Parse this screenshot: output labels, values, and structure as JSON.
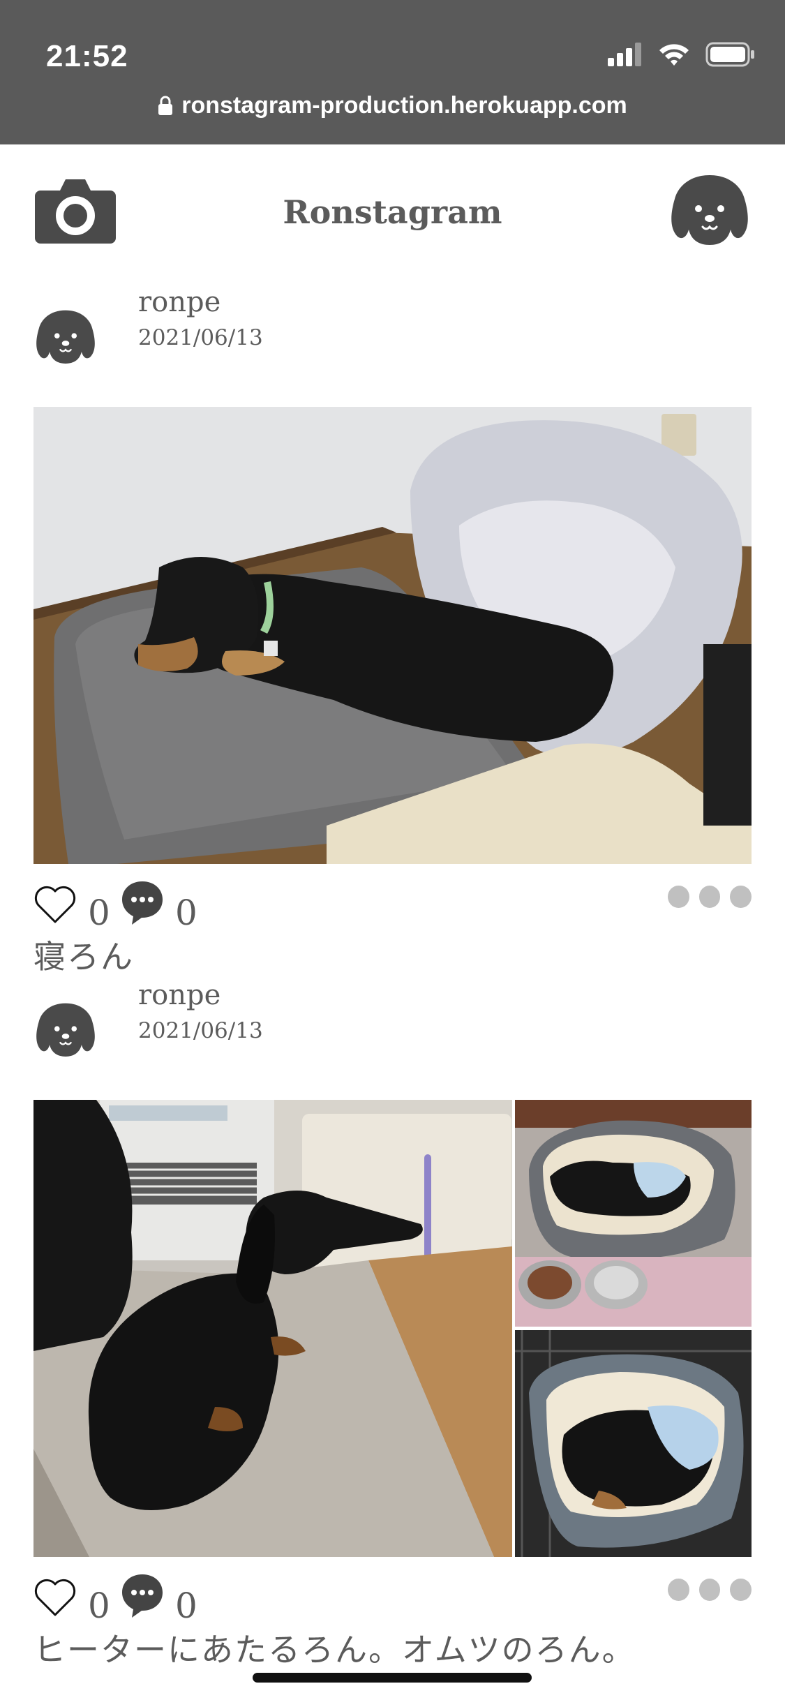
{
  "status_bar": {
    "time": "21:52",
    "url": "ronstagram-production.herokuapp.com",
    "icons": [
      "cellular-signal-icon",
      "wifi-icon",
      "battery-icon",
      "lock-icon"
    ]
  },
  "header": {
    "title": "Ronstagram",
    "left_icon": "camera-icon",
    "right_icon": "dog-face-icon"
  },
  "posts": [
    {
      "username": "ronpe",
      "date": "2021/06/13",
      "photo_alt": "dachshund-sleeping-on-cushion",
      "likes": "0",
      "comments": "0",
      "caption": "寝ろん"
    },
    {
      "username": "ronpe",
      "date": "2021/06/13",
      "photo_alt": "dachshund-by-heater-collage",
      "likes": "0",
      "comments": "0",
      "caption": "ヒーターにあたるろん。オムツのろん。"
    }
  ],
  "colors": {
    "status_bar_bg": "#5a5a5a",
    "text": "#5b5b5b",
    "icon": "#4a4a4a",
    "more_dots": "#c0c0c0"
  }
}
